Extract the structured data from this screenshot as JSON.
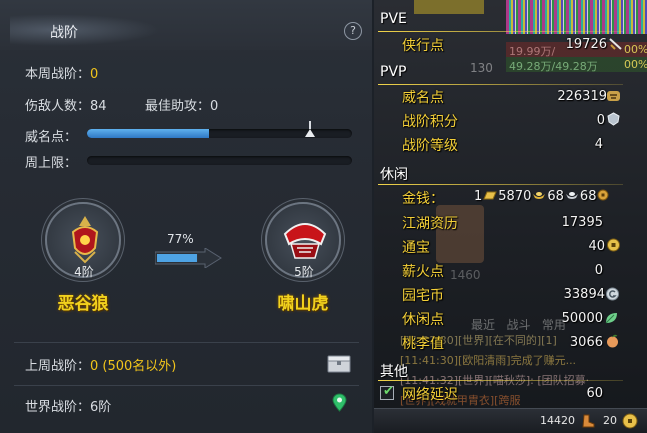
{
  "rank_panel": {
    "title": "战阶",
    "help_icon": "?",
    "weekly_rank_label": "本周战阶：",
    "weekly_rank_value": "0",
    "kills_label": "伤敌人数：",
    "kills_value": "84",
    "assists_label": "最佳助攻：",
    "assists_value": "0",
    "prestige_label": "威名点：",
    "prestige_fill": 0.46,
    "weekly_cap_label": "周上限：",
    "weekly_cap_fill": 0,
    "current_rank": {
      "level": "4阶",
      "name": "恶谷狼"
    },
    "next_rank": {
      "level": "5阶",
      "name": "啸山虎"
    },
    "progress_percent": "77%",
    "progress_fill": 0.77,
    "last_week_label": "上周战阶：",
    "last_week_value": "0 (500名以外)",
    "world_rank_label": "世界战阶：",
    "world_rank_value": "6阶",
    "accent_color": "#f2c51b"
  },
  "currency_panel": {
    "pve": {
      "header": "PVE",
      "items": [
        {
          "label": "侠行点",
          "value": "19726",
          "icon": "sword-icon"
        }
      ]
    },
    "pvp": {
      "header": "PVP",
      "items": [
        {
          "label": "威名点",
          "value": "226319",
          "icon": "tiger-icon"
        },
        {
          "label": "战阶积分",
          "value": "0",
          "icon": "crest-icon"
        },
        {
          "label": "战阶等级",
          "value": "4"
        }
      ]
    },
    "leisure": {
      "header": "休闲",
      "money_label": "金钱：",
      "money": {
        "gold_bars": "1",
        "gold": "5870",
        "silver": "68",
        "copper": "68"
      },
      "items": [
        {
          "label": "江湖资历",
          "value": "17395"
        },
        {
          "label": "通宝",
          "value": "40",
          "icon": "coin-icon"
        },
        {
          "label": "薪火点",
          "value": "0"
        },
        {
          "label": "园宅币",
          "value": "33894",
          "icon": "house-coin-icon"
        },
        {
          "label": "休闲点",
          "value": "50000",
          "icon": "leaf-icon"
        },
        {
          "label": "桃李值",
          "value": "3066",
          "icon": "peach-icon"
        }
      ]
    },
    "other": {
      "header": "其他",
      "items": [
        {
          "label": "网络延迟",
          "value": "60",
          "checked": true
        }
      ]
    },
    "bottom_bar": {
      "value1": "14420",
      "value2": "20"
    },
    "background": {
      "hp_text_1": "19.99万/",
      "hp_pct_1": "00%",
      "hp_text_2": "49.28万/49.28万",
      "hp_pct_2": "00%",
      "level": "130",
      "faded_number": "1460",
      "tabs": "最近   战斗   常用",
      "chat_lines": [
        "[11:31:30][世界][在不同的][1]",
        "[11:41:30][欧阳清雨]完成了赚元...",
        "[11:41:32][世界][喵秋莎]: [团队招募·",
        "[世界][戏就甲胄衣][跨服"
      ]
    }
  }
}
